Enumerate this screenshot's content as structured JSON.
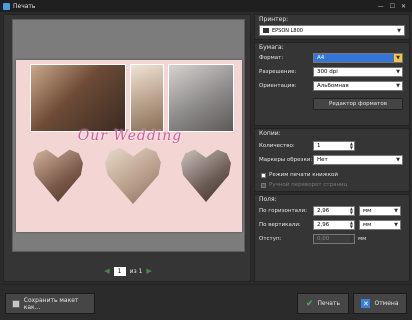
{
  "window": {
    "title": "Печать",
    "minimize": "—",
    "maximize": "☐",
    "close": "✕"
  },
  "preview": {
    "banner_text": "Our Wedding",
    "page_current": "1",
    "page_of": "из 1"
  },
  "printer": {
    "section_label": "Принтер:",
    "name": "EPSON L800"
  },
  "paper": {
    "section_label": "Бумага:",
    "format_label": "Формат:",
    "format_value": "A4",
    "resolution_label": "Разрешение:",
    "resolution_value": "300 dpi",
    "orientation_label": "Ориентация:",
    "orientation_value": "Альбомная",
    "format_editor_button": "Редактор форматов"
  },
  "copies": {
    "section_label": "Копии:",
    "count_label": "Количество:",
    "count_value": "1",
    "crop_marks_label": "Маркеры обрезки:",
    "crop_marks_value": "Нет",
    "booklet_label": "Режим печати книжкой",
    "manual_flip_label": "Ручной переворот страниц"
  },
  "margins": {
    "section_label": "Поля:",
    "horizontal_label": "По горизонтали:",
    "horizontal_value": "2,96",
    "vertical_label": "По вертикали:",
    "vertical_value": "2,96",
    "indent_label": "Отступ:",
    "indent_value": "0,00",
    "unit": "мм"
  },
  "footer": {
    "save_label": "Сохранить макет как...",
    "print_label": "Печать",
    "cancel_label": "Отмена"
  }
}
